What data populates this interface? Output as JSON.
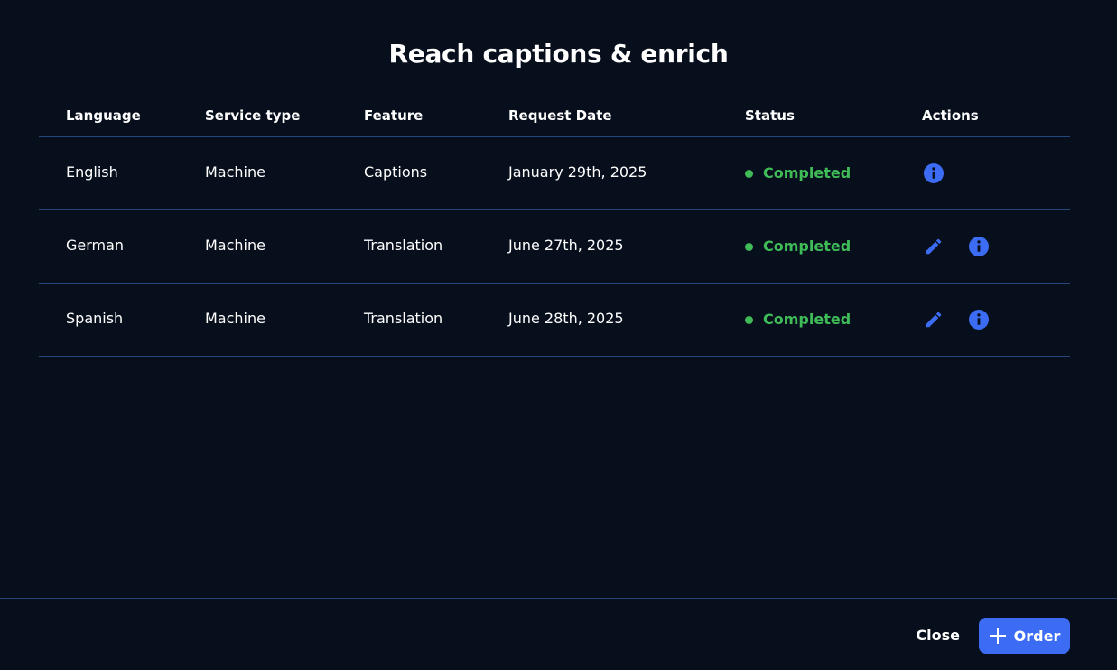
{
  "dialog": {
    "title": "Reach captions & enrich"
  },
  "table": {
    "headers": {
      "language": "Language",
      "service_type": "Service type",
      "feature": "Feature",
      "request_date": "Request Date",
      "status": "Status",
      "actions": "Actions"
    },
    "rows": [
      {
        "language": "English",
        "service_type": "Machine",
        "feature": "Captions",
        "request_date": "January 29th, 2025",
        "status": "Completed",
        "actions": [
          "info-icon"
        ]
      },
      {
        "language": "German",
        "service_type": "Machine",
        "feature": "Translation",
        "request_date": "June 27th, 2025",
        "status": "Completed",
        "actions": [
          "edit-icon",
          "info-icon"
        ]
      },
      {
        "language": "Spanish",
        "service_type": "Machine",
        "feature": "Translation",
        "request_date": "June 28th, 2025",
        "status": "Completed",
        "actions": [
          "edit-icon",
          "info-icon"
        ]
      }
    ]
  },
  "footer": {
    "close_label": "Close",
    "order_label": "Order",
    "order_icon": "plus-icon"
  },
  "colors": {
    "background": "#070e1c",
    "divider": "#24477a",
    "accent": "#3d6cf4",
    "status_completed": "#3fbb57"
  }
}
